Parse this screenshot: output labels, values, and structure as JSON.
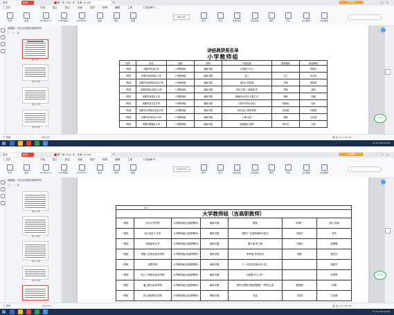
{
  "screens": [
    {
      "tabs": {
        "home": "首页",
        "wps": "稻壳",
        "doc": "第一批 2021 年...名单 (2).pdf",
        "new_tab": "+"
      },
      "login_label": "立即登录",
      "menu": [
        "三 文件",
        "开始",
        "插入",
        "批注",
        "页面",
        "保护",
        "转换",
        "编辑",
        "工具",
        "Q 查找命令..."
      ],
      "tools": [
        "手型",
        "选择",
        "PDF转Word",
        "PDF转图片",
        "PDF转PPT",
        "播放",
        "旋转",
        "截图",
        "单页",
        "双页",
        "连续阅读",
        "自动滚动",
        "翻页",
        "背景",
        "全文翻译",
        "划词翻译"
      ],
      "page_indicator": "99/141",
      "sidebar_title": "缩略图 - 可在此切换页面和预览",
      "sidebar_tools": "□ · 一 · 四",
      "thumb_numbers": [
        "第99页",
        "第100页",
        "第101页",
        "第102页",
        "第103页"
      ],
      "title": "讲经典获奖名单",
      "subtitle": "小学教师组",
      "table_headers": [
        "奖项",
        "单位",
        "组别",
        "类别",
        "作品名称",
        "指导教师",
        "参赛教师"
      ],
      "rows": [
        [
          "一等奖",
          "成都市实验小学",
          "小学教师组",
          "诵读中国",
          "日常始于平凡",
          "",
          "李晓红"
        ],
        [
          "一等奖",
          "成都市龙泉驿区小学",
          "小学教师组",
          "诵读中国",
          "远上",
          "王兰",
          "何文婷"
        ],
        [
          "一等奖",
          "成都市龙泉驿区洪河小学",
          "小学教师组",
          "诵读中国",
          "城北小学新课",
          "马荣",
          "曾晓娟"
        ],
        [
          "一等奖",
          "成都高新区(西区)小学",
          "小学教师组",
          "诵读中国",
          "吾民之敬·一起致敬·吾",
          "黄莹",
          "吴丽"
        ],
        [
          "一等奖",
          "成都市武侯区小学",
          "小学教师组",
          "诵读中国",
          "致敬伟大时代·青春之光",
          "杨莉",
          "何媛"
        ],
        [
          "一等奖",
          "成都市金牛区中学",
          "小学教师组",
          "诵读中国",
          "久恶不尽故乡处与",
          "周静怡",
          "谷欣"
        ],
        [
          "一等奖",
          "成都市天府新区实验小学",
          "小学教师组",
          "诵读中国",
          "地平线上·唯有梦想",
          "邓佳颖",
          "刘丽丽"
        ],
        [
          "一等奖",
          "成都市双流区中小学",
          "小学教师组",
          "诵读中国",
          "七律·长征",
          "唐静",
          "王佳瑞"
        ],
        [
          "一等奖",
          "成都市郫都区小学",
          "小学教师组",
          "诵读中国",
          "最美遇见·追梦",
          "曾丹丹",
          "王丽"
        ]
      ],
      "zoom": "75%",
      "status_left": "□ 导航",
      "status_page": "99/141",
      "clock": "11:21  2021/3/16"
    },
    {
      "tabs": {
        "home": "首页",
        "wps": "稻壳",
        "doc": "第一批 2021 年...名单 (2).pdf",
        "new_tab": "+"
      },
      "login_label": "立即登录",
      "menu": [
        "三 文件",
        "开始",
        "插入",
        "批注",
        "页面",
        "保护",
        "转换",
        "编辑",
        "工具",
        "Q 查找命令..."
      ],
      "tools": [
        "手型",
        "选择",
        "PDF转Word",
        "PDF转图片",
        "PDF转PPT",
        "播放",
        "旋转",
        "截图",
        "单页",
        "双页",
        "连续阅读",
        "自动滚动",
        "翻页",
        "背景",
        "全文翻译",
        "划词翻译"
      ],
      "page_indicator": "141/141",
      "sidebar_title": "缩略图 - 可在此切换页面和预览",
      "sidebar_tools": "□ · 一 · 四",
      "thumb_numbers": [
        "第137页",
        "第138页",
        "第139页",
        "第140页",
        "第141页"
      ],
      "label_box": "(3)",
      "title": "大学教师组（含高职教师）",
      "rows": [
        [
          "一等奖",
          "四川大学学院",
          "大学教师组(含高职教师)",
          "诵读中国",
          "春夜",
          "陈海广",
          "周云  林涛"
        ],
        [
          "一等奖",
          "四川轻化工大学",
          "大学教师组(含高职教师)",
          "诵读中国",
          "望两个·巨我的使命与担当",
          "代晓丹",
          "肖芳"
        ],
        [
          "一等奖",
          "西南医科大学",
          "大学教师组(含高职教师)",
          "诵读中国",
          "遇江南·声之韵",
          "于丽凤",
          "梁雪娜"
        ],
        [
          "一等奖",
          "成都工业职业技术学院",
          "大学教师组(含高职教师)",
          "诵读中国",
          "声声慢·寻寻觅觅",
          "蒲英",
          "曹玉红"
        ],
        [
          "一等奖",
          "西昌学院",
          "大学教师组(含高职教师)",
          "诵读中国",
          "十一月四日风雨大作 其二",
          "",
          "谢晓宇"
        ],
        [
          "一等奖",
          "四川工商职业技术学院",
          "大学教师组(含高职教师)",
          "诵读中国",
          "沁园春·长沙 其一",
          "",
          "刘思思"
        ],
        [
          "一等奖",
          "眉山职业技术学院",
          "大学教师组(含高职教师)",
          "诵读中国",
          "新时代颂歌·唯我青春唯一·梦想·心愿",
          "黄丽娟",
          "何娟"
        ],
        [
          "一等奖",
          "四川财经职业学院",
          "大学教师组(含高职教师)",
          "诵读中国",
          "长征",
          "丁夏苏",
          "王佳琳"
        ]
      ],
      "zoom": "85%",
      "status_left": "□ 导航",
      "status_page": "141/141",
      "clock": "11:22  2021/3/16"
    }
  ],
  "colors": {
    "accent": "#e0443a",
    "zoom": "#2fb34a",
    "taskbar": "#1d2f4f",
    "login": "#f5a623"
  }
}
